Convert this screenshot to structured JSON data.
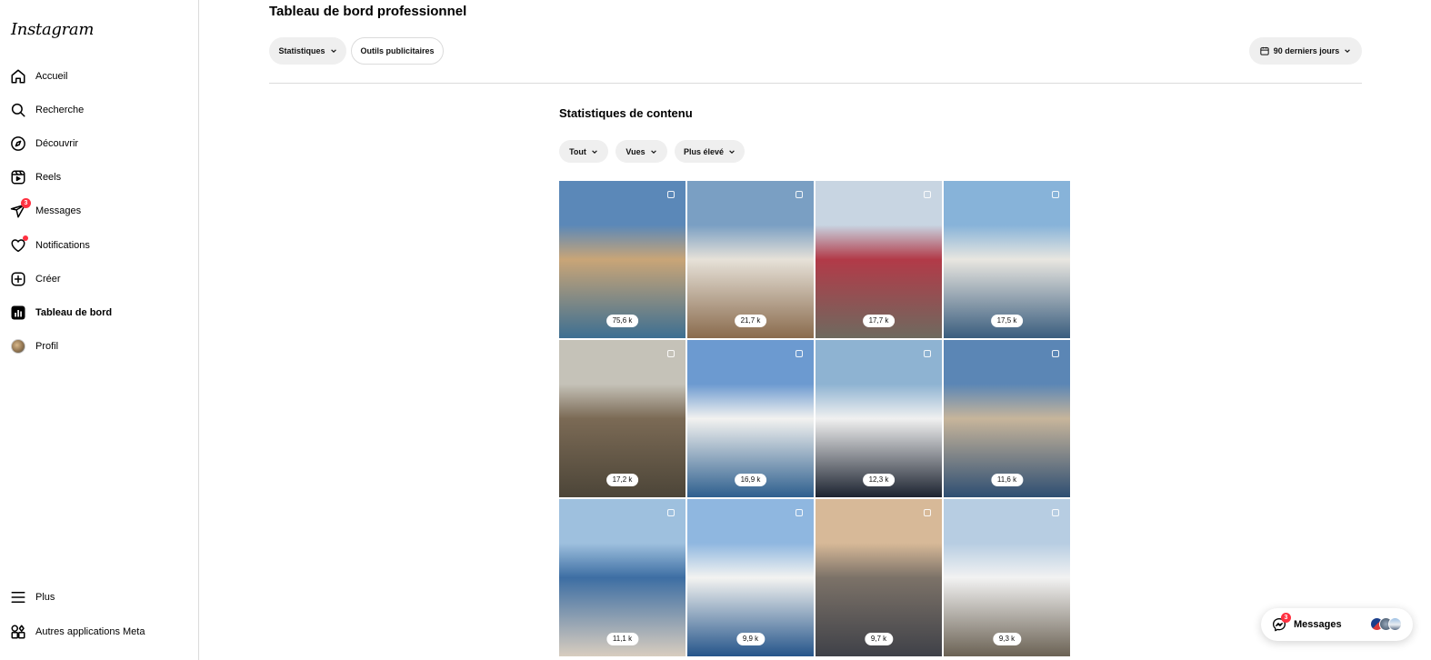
{
  "app": {
    "logo_text": "Instagram"
  },
  "sidebar": {
    "items": [
      {
        "label": "Accueil",
        "icon": "home-icon"
      },
      {
        "label": "Recherche",
        "icon": "search-icon"
      },
      {
        "label": "Découvrir",
        "icon": "compass-icon"
      },
      {
        "label": "Reels",
        "icon": "reels-icon"
      },
      {
        "label": "Messages",
        "icon": "messages-icon",
        "badge": "3"
      },
      {
        "label": "Notifications",
        "icon": "heart-icon"
      },
      {
        "label": "Créer",
        "icon": "plus-square-icon"
      },
      {
        "label": "Tableau de bord",
        "icon": "dashboard-icon",
        "active": true
      },
      {
        "label": "Profil",
        "icon": "avatar"
      }
    ],
    "bottom": [
      {
        "label": "Plus",
        "icon": "menu-icon"
      },
      {
        "label": "Autres applications Meta",
        "icon": "meta-apps-icon"
      }
    ]
  },
  "header": {
    "title": "Tableau de bord professionnel",
    "stats_button": "Statistiques",
    "ads_button": "Outils publicitaires",
    "range_button": "90 derniers jours"
  },
  "content": {
    "title": "Statistiques de contenu",
    "filters": {
      "type": "Tout",
      "metric": "Vues",
      "sort": "Plus élevé"
    },
    "posts": [
      {
        "views": "75,6 k",
        "colors": [
          "#5b88b8",
          "#c9a577",
          "#3d6f92"
        ]
      },
      {
        "views": "21,7 k",
        "colors": [
          "#7a9fc3",
          "#e6e1d8",
          "#8a6b4d"
        ]
      },
      {
        "views": "17,7 k",
        "colors": [
          "#c8d5e2",
          "#b23a48",
          "#6e6a5f"
        ]
      },
      {
        "views": "17,5 k",
        "colors": [
          "#87b3d9",
          "#e8e6e0",
          "#3a5d7e"
        ]
      },
      {
        "views": "17,2 k",
        "colors": [
          "#c5c2b8",
          "#7b6a55",
          "#4c4538"
        ]
      },
      {
        "views": "16,9 k",
        "colors": [
          "#6c9ad0",
          "#f2f2f0",
          "#2e5f8e"
        ]
      },
      {
        "views": "12,3 k",
        "colors": [
          "#8eb3d2",
          "#f0f0f0",
          "#1c2330"
        ]
      },
      {
        "views": "11,6 k",
        "colors": [
          "#5b86b5",
          "#c7b59b",
          "#2e4e72"
        ]
      },
      {
        "views": "11,1 k",
        "colors": [
          "#9ec0de",
          "#3d6ea3",
          "#d8cdbf"
        ]
      },
      {
        "views": "9,9 k",
        "colors": [
          "#8fb7e0",
          "#f3f3f1",
          "#25558a"
        ]
      },
      {
        "views": "9,7 k",
        "colors": [
          "#d7b998",
          "#7c7268",
          "#3f4148"
        ]
      },
      {
        "views": "9,3 k",
        "colors": [
          "#b7cde2",
          "#f2f2f2",
          "#6b6254"
        ]
      }
    ]
  },
  "floating_messages": {
    "label": "Messages",
    "badge": "3"
  }
}
